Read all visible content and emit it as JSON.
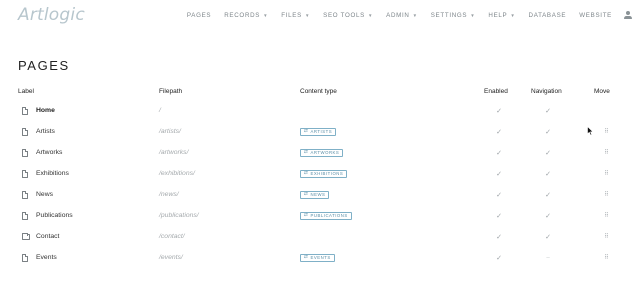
{
  "header": {
    "logo": "Artlogic",
    "nav": [
      {
        "label": "PAGES",
        "caret": false
      },
      {
        "label": "RECORDS",
        "caret": true
      },
      {
        "label": "FILES",
        "caret": true
      },
      {
        "label": "SEO TOOLS",
        "caret": true
      },
      {
        "label": "ADMIN",
        "caret": true
      },
      {
        "label": "SETTINGS",
        "caret": true
      },
      {
        "label": "HELP",
        "caret": true
      },
      {
        "label": "DATABASE",
        "caret": false
      },
      {
        "label": "WEBSITE",
        "caret": false
      }
    ],
    "user_icon": "user-icon"
  },
  "page": {
    "title": "PAGES"
  },
  "table": {
    "columns": {
      "label": "Label",
      "filepath": "Filepath",
      "content_type": "Content type",
      "enabled": "Enabled",
      "navigation": "Navigation",
      "move": "Move"
    },
    "rows": [
      {
        "icon": "file-icon",
        "label": "Home",
        "bold": true,
        "filepath": "/",
        "content_type": "",
        "enabled": "✓",
        "navigation": "✓",
        "move": ""
      },
      {
        "icon": "file-icon",
        "label": "Artists",
        "bold": false,
        "filepath": "/artists/",
        "content_type": "ARTISTS",
        "enabled": "✓",
        "navigation": "✓",
        "move": "⠿"
      },
      {
        "icon": "file-icon",
        "label": "Artworks",
        "bold": false,
        "filepath": "/artworks/",
        "content_type": "ARTWORKS",
        "enabled": "✓",
        "navigation": "✓",
        "move": "⠿"
      },
      {
        "icon": "file-icon",
        "label": "Exhibitions",
        "bold": false,
        "filepath": "/exhibitions/",
        "content_type": "EXHIBITIONS",
        "enabled": "✓",
        "navigation": "✓",
        "move": "⠿"
      },
      {
        "icon": "file-icon",
        "label": "News",
        "bold": false,
        "filepath": "/news/",
        "content_type": "NEWS",
        "enabled": "✓",
        "navigation": "✓",
        "move": "⠿"
      },
      {
        "icon": "file-icon",
        "label": "Publications",
        "bold": false,
        "filepath": "/publications/",
        "content_type": "PUBLICATIONS",
        "enabled": "✓",
        "navigation": "✓",
        "move": "⠿"
      },
      {
        "icon": "folder-icon",
        "label": "Contact",
        "bold": false,
        "filepath": "/contact/",
        "content_type": "",
        "enabled": "✓",
        "navigation": "✓",
        "move": "⠿"
      },
      {
        "icon": "file-icon",
        "label": "Events",
        "bold": false,
        "filepath": "/events/",
        "content_type": "EVENTS",
        "enabled": "✓",
        "navigation": "–",
        "move": "⠿"
      }
    ]
  },
  "tag_icon": "⇄",
  "colors": {
    "logo": "#b7c6cd",
    "tag_border": "#7fb0c7",
    "tag_text": "#5b8fa8",
    "muted_text": "#a5aaad"
  }
}
